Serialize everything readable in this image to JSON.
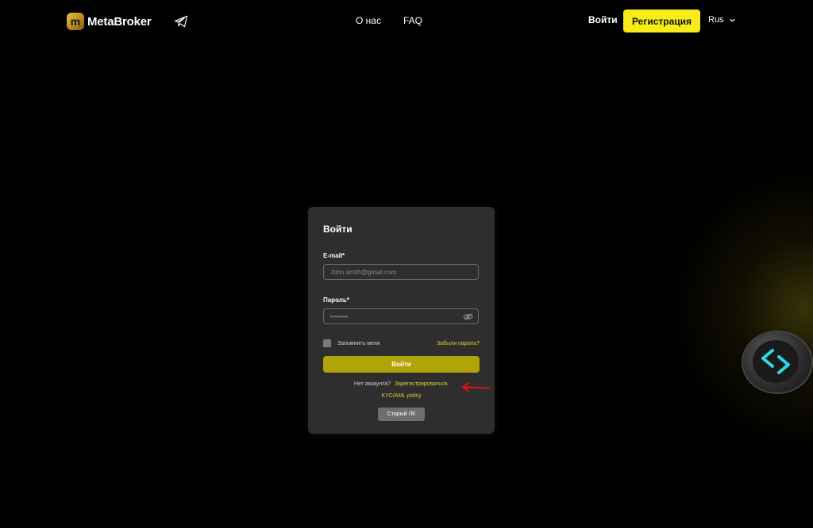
{
  "header": {
    "brand": "MetaBroker",
    "logo_letter": "m",
    "nav": [
      {
        "label": "О нас"
      },
      {
        "label": "FAQ"
      }
    ],
    "login_label": "Войти",
    "register_label": "Регистрация",
    "language": "Rus"
  },
  "login_form": {
    "title": "Войти",
    "email_label": "E-mail*",
    "email_placeholder": "John.smith@gmail.com",
    "password_label": "Пароль*",
    "password_value": "••••••••",
    "remember_label": "Запомнить меня",
    "forgot_label": "Забыли пароль?",
    "submit_label": "Войти",
    "no_account_text": "Нет аккаунта?",
    "register_link": "Зарегистрироваться.",
    "kyc_link": "KYC/AML policy",
    "old_account_label": "Старый ЛК"
  },
  "colors": {
    "accent_yellow": "#f7ec19",
    "submit_olive": "#b0a408",
    "link_yellow": "#e0d22a",
    "card_bg": "#2e2e2e",
    "annotation_red": "#e01010",
    "widget_cyan": "#2bd9e8"
  },
  "icons": {
    "telegram": "telegram-icon",
    "eye_off": "eye-off-icon",
    "chevron": "chevron-down-icon",
    "widget": "chevron-arrows-icon"
  }
}
